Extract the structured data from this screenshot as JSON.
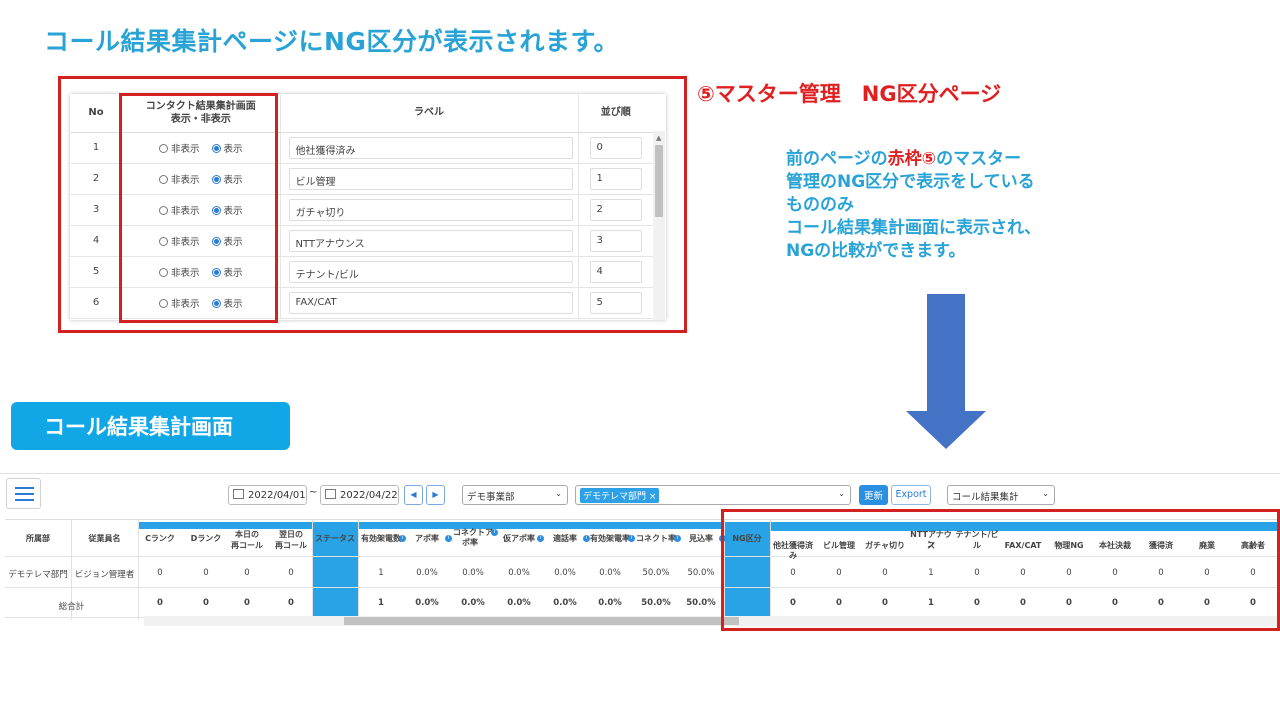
{
  "heading": "コール結果集計ページにNG区分が表示されます。",
  "master": {
    "title": "⑤マスター管理　NG区分ページ",
    "headers": {
      "no": "No",
      "display_line1": "コンタクト結果集計画面",
      "display_line2": "表示・非表示",
      "label": "ラベル",
      "order": "並び順"
    },
    "option_hide": "非表示",
    "option_show": "表示",
    "rows": [
      {
        "no": "1",
        "label": "他社獲得済み",
        "order": "0"
      },
      {
        "no": "2",
        "label": "ビル管理",
        "order": "1"
      },
      {
        "no": "3",
        "label": "ガチャ切り",
        "order": "2"
      },
      {
        "no": "4",
        "label": "NTTアナウンス",
        "order": "3"
      },
      {
        "no": "5",
        "label": "テナント/ビル",
        "order": "4"
      },
      {
        "no": "6",
        "label": "FAX/CAT",
        "order": "5"
      }
    ]
  },
  "note": {
    "line1_pre": "前のページの",
    "line1_red": "赤枠⑤",
    "line1_post": "のマスター",
    "line2": "管理のNG区分で表示をしている",
    "line3": "もののみ",
    "line4": "コール結果集計画面に表示され、",
    "line5": "NGの比較ができます。"
  },
  "badge": "コール結果集計画面",
  "toolbar": {
    "date_from": "2022/04/01",
    "date_sep": "~",
    "date_to": "2022/04/22",
    "prev": "◀",
    "next": "▶",
    "office": "デモ事業部",
    "dept_tag": "デモテレマ部門",
    "dept_tag_close": "×",
    "update": "更新",
    "export": "Export",
    "report": "コール結果集計"
  },
  "grid": {
    "col_dept": "所属部",
    "col_staff": "従業員名",
    "col_c": "Cランク",
    "col_d": "Dランク",
    "col_today_1": "本日の",
    "col_today_2": "再コール",
    "col_next_1": "翌日の",
    "col_next_2": "再コール",
    "col_status": "ステータス",
    "metrics": [
      "有効架電数",
      "アポ率",
      "コネクトア",
      "仮アポ率",
      "適話率",
      "有効架電率",
      "コネクト率",
      "見込率"
    ],
    "metric_conn_2": "ポ率",
    "ng_header": "NG区分",
    "ng_cols": [
      "他社獲得済み",
      "ビル管理",
      "ガチャ切り",
      "NTTアナウン",
      "テナント/ビ",
      "FAX/CAT",
      "物理NG",
      "本社決裁",
      "獲得済",
      "廃業",
      "高齢者"
    ],
    "ng_cols_2": [
      "",
      "",
      "",
      "ス",
      "ル",
      "",
      "",
      "",
      "",
      "",
      ""
    ],
    "row_dept": "デモテレマ部門",
    "row_staff": "ビジョン管理者",
    "row_vals": [
      "0",
      "0",
      "0",
      "0"
    ],
    "row_metrics": [
      "1",
      "0.0%",
      "0.0%",
      "0.0%",
      "0.0%",
      "0.0%",
      "50.0%",
      "50.0%"
    ],
    "row_ng": [
      "0",
      "0",
      "0",
      "1",
      "0",
      "0",
      "0",
      "0",
      "0",
      "0",
      "0"
    ],
    "total_label": "総合計",
    "total_vals": [
      "0",
      "0",
      "0",
      "0"
    ],
    "total_metrics": [
      "1",
      "0.0%",
      "0.0%",
      "0.0%",
      "0.0%",
      "0.0%",
      "50.0%",
      "50.0%"
    ],
    "total_ng": [
      "0",
      "0",
      "0",
      "1",
      "0",
      "0",
      "0",
      "0",
      "0",
      "0",
      "0"
    ]
  },
  "colors": {
    "accent": "#29a3d6",
    "red": "#e02020",
    "arrow": "#4472c4",
    "badge": "#11a6e6"
  }
}
